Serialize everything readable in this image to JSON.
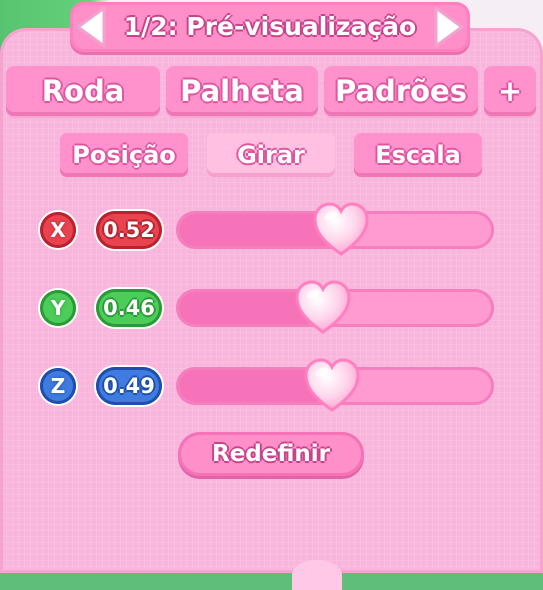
{
  "header": {
    "title": "1/2: Pré-visualização",
    "prev_icon": "triangle-left-icon",
    "next_icon": "triangle-right-icon"
  },
  "tabs": [
    {
      "label": "Roda"
    },
    {
      "label": "Palheta"
    },
    {
      "label": "Padrões"
    },
    {
      "label": "+"
    }
  ],
  "subtabs": [
    {
      "label": "Posição",
      "active": false
    },
    {
      "label": "Girar",
      "active": true
    },
    {
      "label": "Escala",
      "active": false
    }
  ],
  "sliders": [
    {
      "axis": "X",
      "value": "0.52",
      "fraction": 0.52,
      "color": "#e8434f",
      "dark": "#b8232f"
    },
    {
      "axis": "Y",
      "value": "0.46",
      "fraction": 0.46,
      "color": "#4ccc58",
      "dark": "#2a9a36"
    },
    {
      "axis": "Z",
      "value": "0.49",
      "fraction": 0.49,
      "color": "#3f7be0",
      "dark": "#1f4faa"
    }
  ],
  "thumb_icon": "heart-icon",
  "reset": {
    "label": "Redefinir"
  },
  "colors": {
    "panel": "#f9b6dc",
    "button": "#ff92cc",
    "active_button": "#ffc0e2"
  }
}
